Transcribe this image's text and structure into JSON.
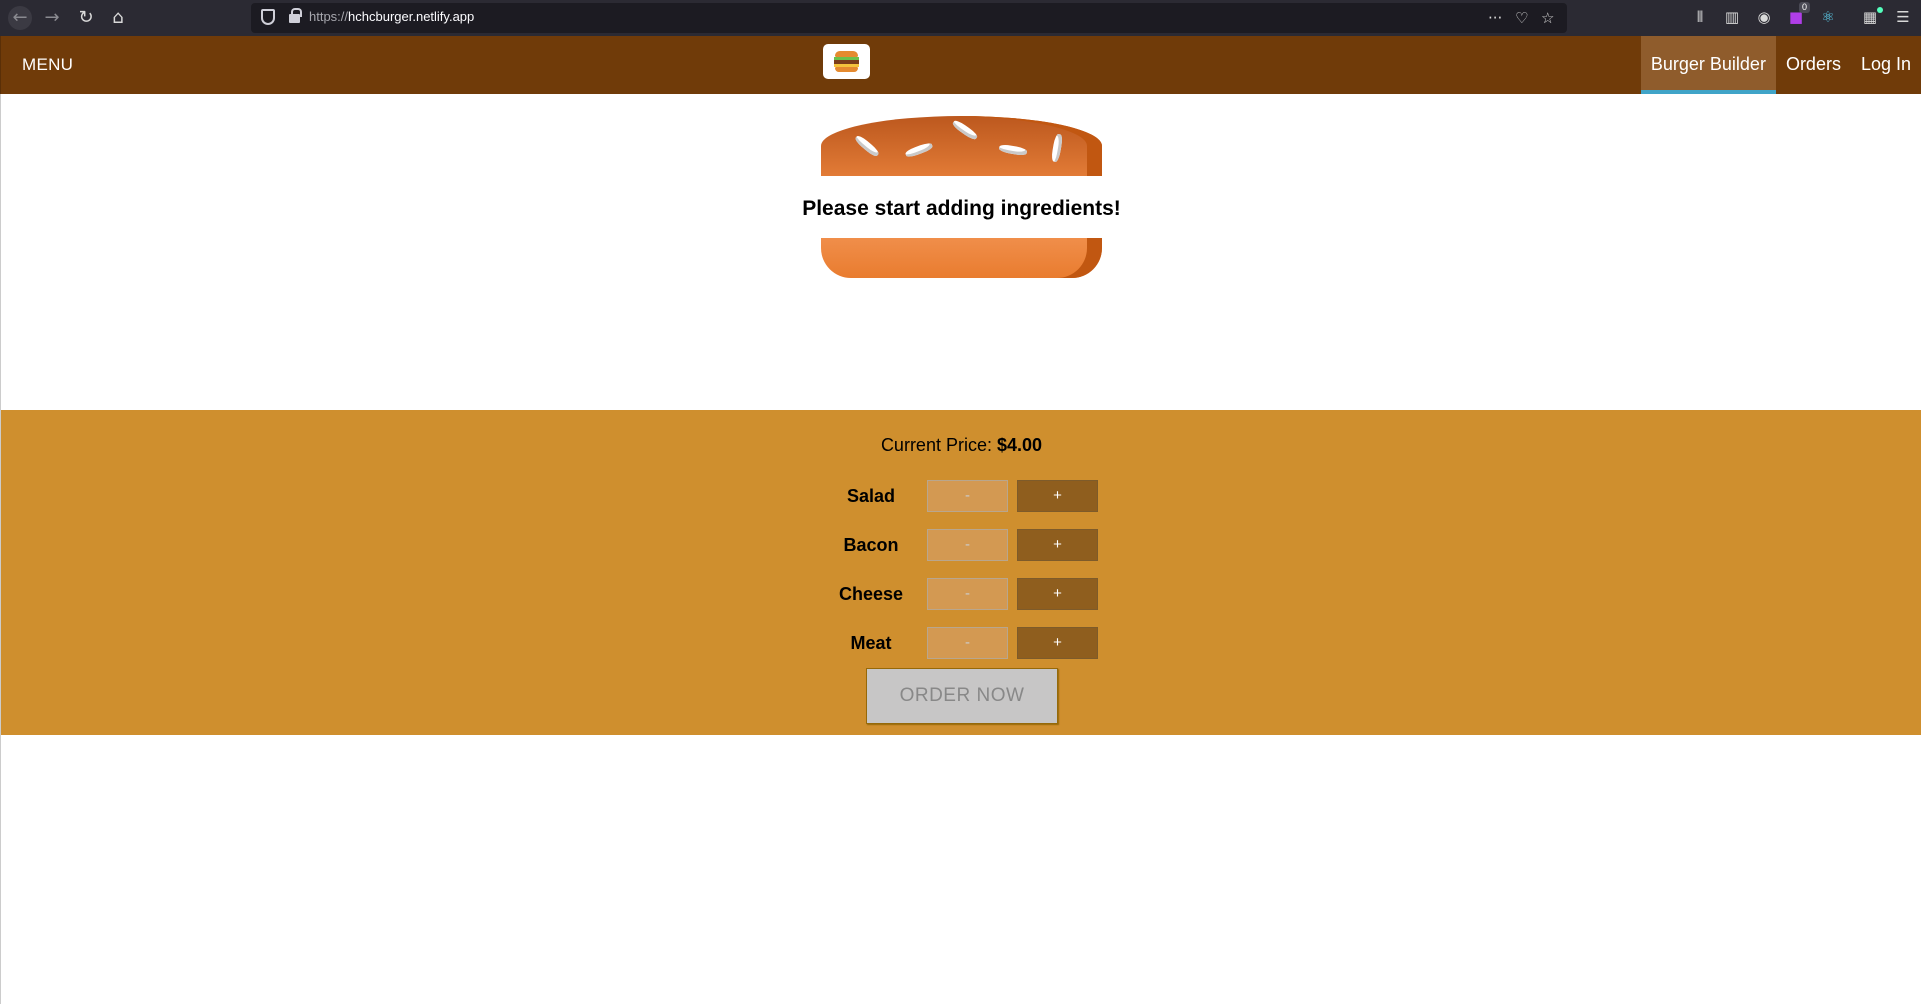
{
  "browser": {
    "url_scheme": "https://",
    "url_host": "hchcburger.netlify.app",
    "extension_badge": "0"
  },
  "toolbar": {
    "menu_label": "MENU",
    "nav": [
      {
        "label": "Burger Builder",
        "active": true
      },
      {
        "label": "Orders",
        "active": false
      },
      {
        "label": "Log In",
        "active": false
      }
    ]
  },
  "burger": {
    "empty_message": "Please start adding ingredients!"
  },
  "controls": {
    "price_label": "Current Price:",
    "price_value": "$4.00",
    "less_label": "-",
    "more_label": "+",
    "ingredients": [
      {
        "label": "Salad"
      },
      {
        "label": "Bacon"
      },
      {
        "label": "Cheese"
      },
      {
        "label": "Meat"
      }
    ],
    "order_label": "ORDER NOW"
  },
  "colors": {
    "toolbar_bg": "#703b09",
    "controls_bg": "#cf8f2e",
    "active_nav_bg": "#8f5c2c",
    "active_nav_border": "#40a4c8"
  }
}
